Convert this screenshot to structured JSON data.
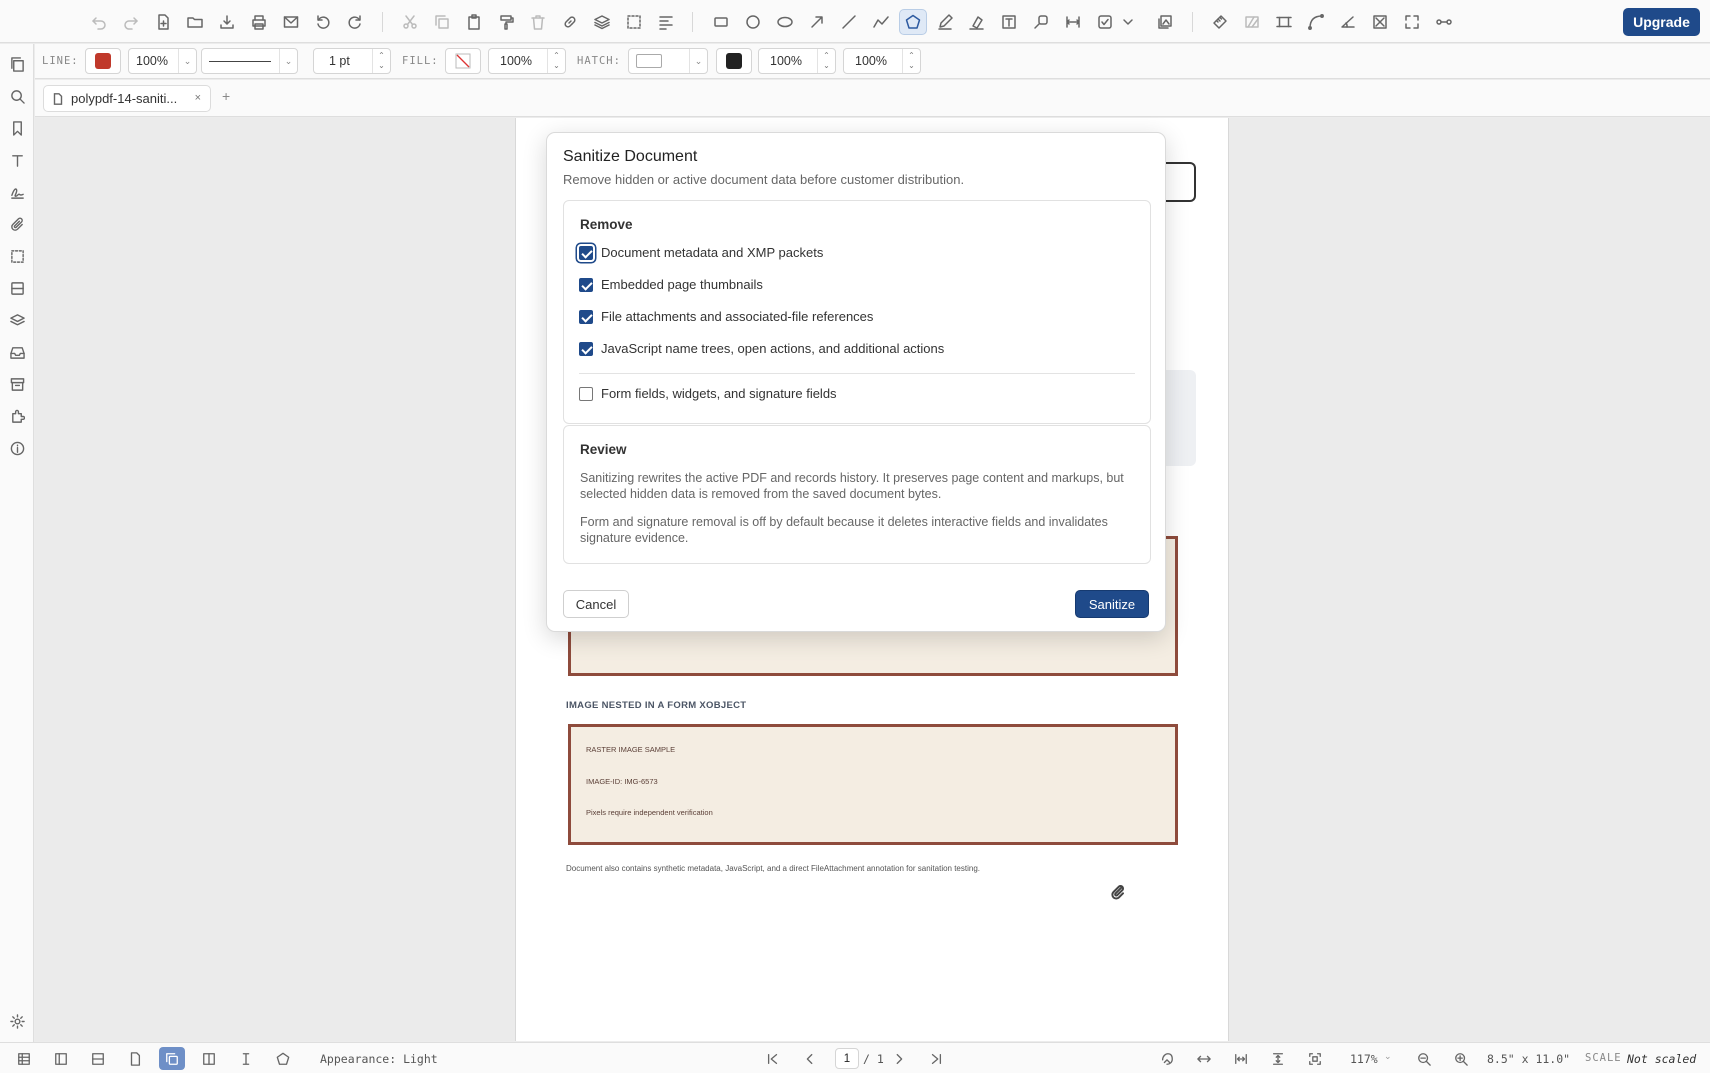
{
  "toolbar": {
    "upgrade_label": "Upgrade",
    "icons": [
      "undo-icon",
      "redo-icon",
      "new-file-icon",
      "open-folder-icon",
      "download-icon",
      "print-icon",
      "mail-icon",
      "rotate-left-icon",
      "rotate-right-icon",
      "cut-icon",
      "copy-icon",
      "paste-icon",
      "format-painter-icon",
      "delete-icon",
      "link-icon",
      "layers-icon",
      "select-area-icon",
      "align-icon",
      "rectangle-icon",
      "circle-icon",
      "ellipse-icon",
      "arrow-icon",
      "line-icon",
      "polyline-icon",
      "polygon-icon",
      "pen-icon",
      "highlighter-icon",
      "text-box-icon",
      "callout-icon",
      "dimension-icon",
      "checkbox-field-icon",
      "more-chevron-icon",
      "image-stamp-icon",
      "measure-icon",
      "hatch-icon",
      "crop-icon",
      "curve-icon",
      "angle-icon",
      "redact-icon",
      "fullscreen-icon",
      "connector-icon"
    ],
    "active_tool": "polygon-icon"
  },
  "propbar": {
    "line_label": "LINE:",
    "line_color": "#c0392b",
    "line_opacity": "100%",
    "stroke_width": "1 pt",
    "fill_label": "FILL:",
    "fill_opacity": "100%",
    "hatch_label": "HATCH:",
    "hatch_color": "#222222",
    "hatch_opacity_1": "100%",
    "hatch_opacity_2": "100%"
  },
  "tabs": {
    "doc_tab": "polypdf-14-saniti...",
    "close": "×",
    "add": "+"
  },
  "document": {
    "section_title": "IMAGE NESTED IN A FORM XOBJECT",
    "raster_title": "RASTER IMAGE SAMPLE",
    "image_id": "IMAGE-ID: IMG-6573",
    "pixels_note": "Pixels require independent verification",
    "footer_note": "Document also contains synthetic metadata, JavaScript, and a direct FileAttachment annotation for sanitation testing."
  },
  "modal": {
    "title": "Sanitize Document",
    "subtitle": "Remove hidden or active document data before customer distribution.",
    "remove_title": "Remove",
    "options": [
      {
        "label": "Document metadata and XMP packets",
        "checked": true
      },
      {
        "label": "Embedded page thumbnails",
        "checked": true
      },
      {
        "label": "File attachments and associated-file references",
        "checked": true
      },
      {
        "label": "JavaScript name trees, open actions, and additional actions",
        "checked": true
      },
      {
        "label": "Form fields, widgets, and signature fields",
        "checked": false
      }
    ],
    "review_title": "Review",
    "review_p1": "Sanitizing rewrites the active PDF and records history. It preserves page content and markups, but selected hidden data is removed from the saved document bytes.",
    "review_p2": "Form and signature removal is off by default because it deletes interactive fields and invalidates signature evidence.",
    "cancel_label": "Cancel",
    "sanitize_label": "Sanitize"
  },
  "statusbar": {
    "appearance": "Appearance: Light",
    "page_current": "1",
    "page_total": "/ 1",
    "zoom": "117%",
    "page_size": "8.5\" x 11.0\"",
    "scale_label": "SCALE",
    "scale_value": "Not scaled"
  }
}
